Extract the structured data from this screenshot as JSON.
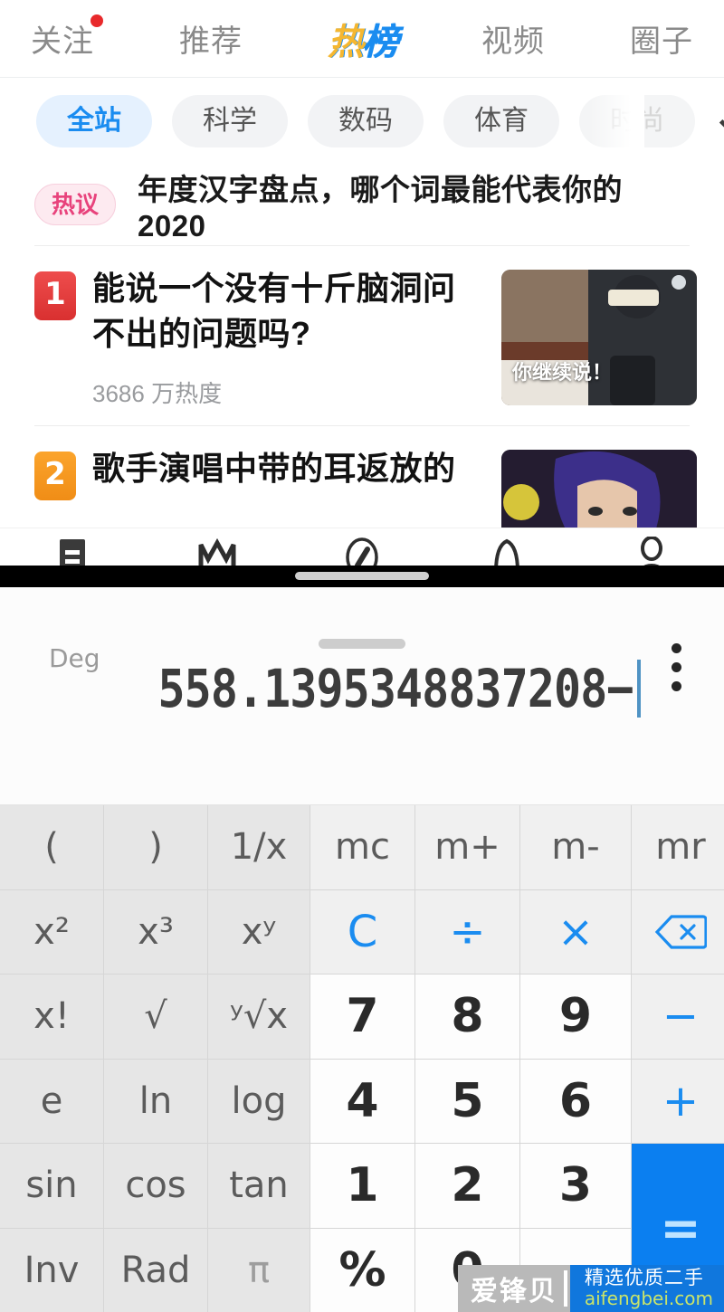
{
  "background_app": {
    "top_tabs": [
      {
        "label": "关注",
        "active": false,
        "badge": true
      },
      {
        "label": "推荐",
        "active": false,
        "badge": false
      },
      {
        "label": "热榜",
        "active": true,
        "badge": false
      },
      {
        "label": "视频",
        "active": false,
        "badge": false
      },
      {
        "label": "圈子",
        "active": false,
        "badge": false
      }
    ],
    "category_chips": [
      {
        "label": "全站",
        "active": true,
        "faded": false
      },
      {
        "label": "科学",
        "active": false,
        "faded": false
      },
      {
        "label": "数码",
        "active": false,
        "faded": false
      },
      {
        "label": "体育",
        "active": false,
        "faded": false
      },
      {
        "label": "时尚",
        "active": false,
        "faded": true
      }
    ],
    "expand_icon": "chevron-down-icon",
    "hot_banner": {
      "tag": "热议",
      "title": "年度汉字盘点，哪个词最能代表你的2020"
    },
    "feed": [
      {
        "rank": "1",
        "title": "能说一个没有十斤脑洞问不出的问题吗?",
        "heat": "3686 万热度",
        "thumb_caption": "你继续说！"
      },
      {
        "rank": "2",
        "title": "歌手演唱中带的耳返放的",
        "heat": "",
        "thumb_caption": ""
      }
    ],
    "bottom_nav": [
      {
        "icon": "feed-icon",
        "label": ""
      },
      {
        "icon": "crown-icon",
        "label": ""
      },
      {
        "icon": "compass-icon",
        "label": ""
      },
      {
        "icon": "bell-icon",
        "label": ""
      },
      {
        "icon": "person-icon",
        "label": ""
      }
    ]
  },
  "calculator": {
    "angle_mode": "Deg",
    "expression": "558.1395348837208−",
    "overflow_menu_icon": "kebab-menu-icon",
    "drag_handle_icon": "drag-handle-icon",
    "accent_color": "#1a8cf0",
    "equals_bg_color": "#0b7ff0",
    "keys": [
      {
        "label": "(",
        "type": "fn",
        "name": "key-open-paren"
      },
      {
        "label": ")",
        "type": "fn",
        "name": "key-close-paren"
      },
      {
        "label": "1/x",
        "type": "fn",
        "name": "key-reciprocal"
      },
      {
        "label": "mc",
        "type": "mem",
        "name": "key-memory-clear"
      },
      {
        "label": "m+",
        "type": "mem",
        "name": "key-memory-add"
      },
      {
        "label": "m-",
        "type": "mem",
        "name": "key-memory-subtract"
      },
      {
        "label": "mr",
        "type": "mem",
        "name": "key-memory-recall"
      },
      {
        "label": "x²",
        "type": "fn",
        "name": "key-square"
      },
      {
        "label": "x³",
        "type": "fn",
        "name": "key-cube"
      },
      {
        "label": "xʸ",
        "type": "fn",
        "name": "key-power"
      },
      {
        "label": "C",
        "type": "op",
        "name": "key-clear"
      },
      {
        "label": "÷",
        "type": "op",
        "name": "key-divide"
      },
      {
        "label": "×",
        "type": "op",
        "name": "key-multiply"
      },
      {
        "label": "⌫",
        "type": "op",
        "name": "key-backspace"
      },
      {
        "label": "x!",
        "type": "fn",
        "name": "key-factorial"
      },
      {
        "label": "√",
        "type": "fn",
        "name": "key-square-root"
      },
      {
        "label": "ʸ√x",
        "type": "fn",
        "name": "key-nth-root"
      },
      {
        "label": "7",
        "type": "num",
        "name": "key-7"
      },
      {
        "label": "8",
        "type": "num",
        "name": "key-8"
      },
      {
        "label": "9",
        "type": "num",
        "name": "key-9"
      },
      {
        "label": "−",
        "type": "op",
        "name": "key-subtract"
      },
      {
        "label": "e",
        "type": "fn",
        "name": "key-e"
      },
      {
        "label": "ln",
        "type": "fn",
        "name": "key-natural-log"
      },
      {
        "label": "log",
        "type": "fn",
        "name": "key-log"
      },
      {
        "label": "4",
        "type": "num",
        "name": "key-4"
      },
      {
        "label": "5",
        "type": "num",
        "name": "key-5"
      },
      {
        "label": "6",
        "type": "num",
        "name": "key-6"
      },
      {
        "label": "+",
        "type": "op",
        "name": "key-add"
      },
      {
        "label": "sin",
        "type": "fn",
        "name": "key-sin"
      },
      {
        "label": "cos",
        "type": "fn",
        "name": "key-cos"
      },
      {
        "label": "tan",
        "type": "fn",
        "name": "key-tan"
      },
      {
        "label": "1",
        "type": "num",
        "name": "key-1"
      },
      {
        "label": "2",
        "type": "num",
        "name": "key-2"
      },
      {
        "label": "3",
        "type": "num",
        "name": "key-3"
      },
      {
        "label": "=",
        "type": "eq",
        "name": "key-equals"
      },
      {
        "label": "Inv",
        "type": "fn",
        "name": "key-inverse"
      },
      {
        "label": "Rad",
        "type": "fn",
        "name": "key-radian-toggle"
      },
      {
        "label": "π",
        "type": "pi",
        "name": "key-pi"
      },
      {
        "label": "%",
        "type": "num",
        "name": "key-percent"
      },
      {
        "label": "0",
        "type": "num",
        "name": "key-0"
      },
      {
        "label": ".",
        "type": "num",
        "name": "key-decimal"
      }
    ]
  },
  "watermark": {
    "brand": "爱锋贝",
    "tagline": "精选优质二手",
    "url": "aifengbei.com"
  }
}
